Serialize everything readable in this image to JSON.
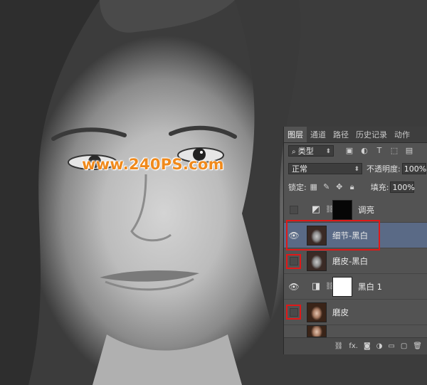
{
  "watermark": "www.240PS.com",
  "layers_panel": {
    "tabs": [
      {
        "label": "图层",
        "active": true
      },
      {
        "label": "通道",
        "active": false
      },
      {
        "label": "路径",
        "active": false
      },
      {
        "label": "历史记录",
        "active": false
      },
      {
        "label": "动作",
        "active": false
      }
    ],
    "filter": {
      "label": "类型"
    },
    "blend_mode": "正常",
    "opacity": {
      "label": "不透明度:",
      "value": "100%"
    },
    "lock": {
      "label": "锁定:"
    },
    "fill": {
      "label": "填充:",
      "value": "100%"
    },
    "layers": [
      {
        "name": "调亮",
        "visible": false,
        "type": "adjustment",
        "mask": "black"
      },
      {
        "name": "细节-黑白",
        "visible": true,
        "type": "photo",
        "selected": true
      },
      {
        "name": "磨皮-黑白",
        "visible": false,
        "type": "photo"
      },
      {
        "name": "黑白 1",
        "visible": true,
        "type": "adjustment",
        "mask": "white"
      },
      {
        "name": "磨皮",
        "visible": false,
        "type": "photo-color"
      }
    ],
    "footer_icons": [
      "link-icon",
      "fx-icon",
      "mask-icon",
      "adjustment-icon",
      "group-icon",
      "new-layer-icon",
      "trash-icon"
    ],
    "fx_label": "fx."
  },
  "colors": {
    "highlight": "#e01818",
    "watermark": "#f08a1c",
    "selected_layer": "#5a6a86"
  }
}
